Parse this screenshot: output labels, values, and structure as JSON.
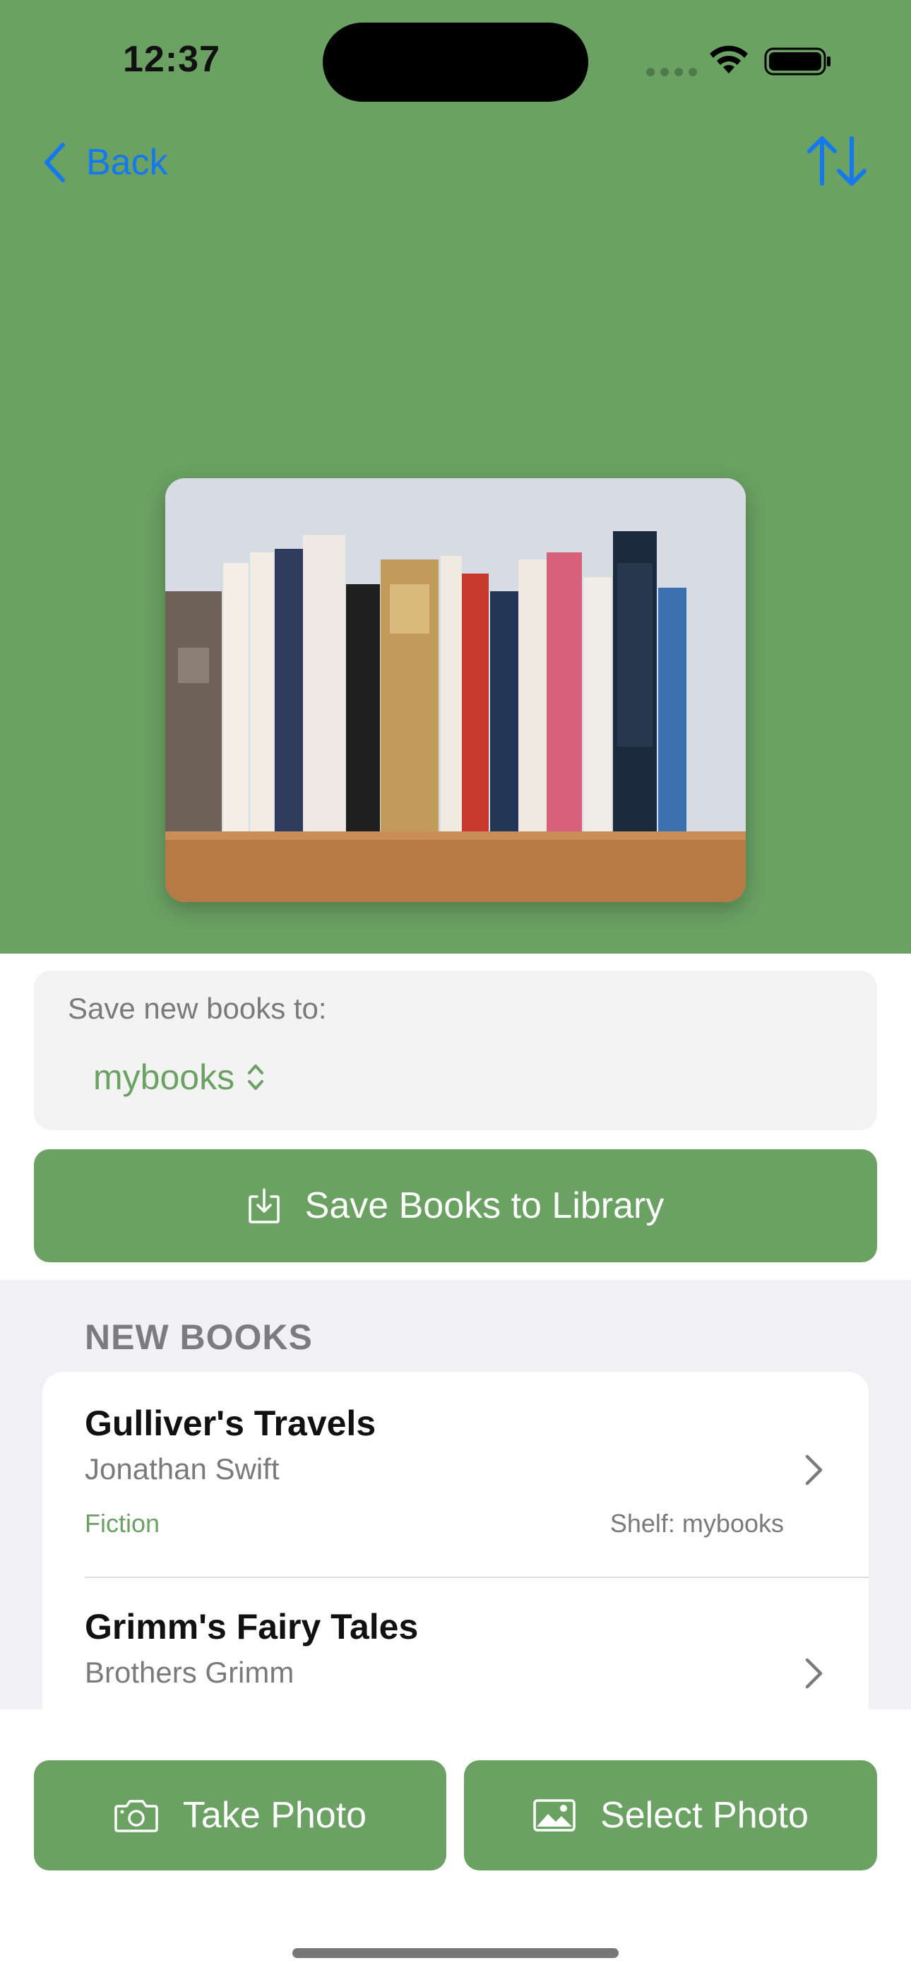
{
  "status_bar": {
    "time": "12:37"
  },
  "nav": {
    "back_label": "Back",
    "sort_icon": "arrow-up-down-icon"
  },
  "hero": {
    "photo_alt": "Photo of books on a shelf"
  },
  "destination": {
    "label": "Save new books to:",
    "selected_shelf": "mybooks"
  },
  "save_button": {
    "label": "Save Books to Library"
  },
  "list": {
    "section_title": "NEW BOOKS",
    "books": [
      {
        "title": "Gulliver's Travels",
        "author": "Jonathan Swift",
        "genre": "Fiction",
        "shelf": "Shelf: mybooks"
      },
      {
        "title": "Grimm's Fairy Tales",
        "author": "Brothers Grimm"
      }
    ]
  },
  "actions": {
    "take_photo": "Take Photo",
    "select_photo": "Select Photo"
  },
  "colors": {
    "accent": "#6BA163",
    "link": "#1478F0",
    "background": "#F1F1F5"
  }
}
